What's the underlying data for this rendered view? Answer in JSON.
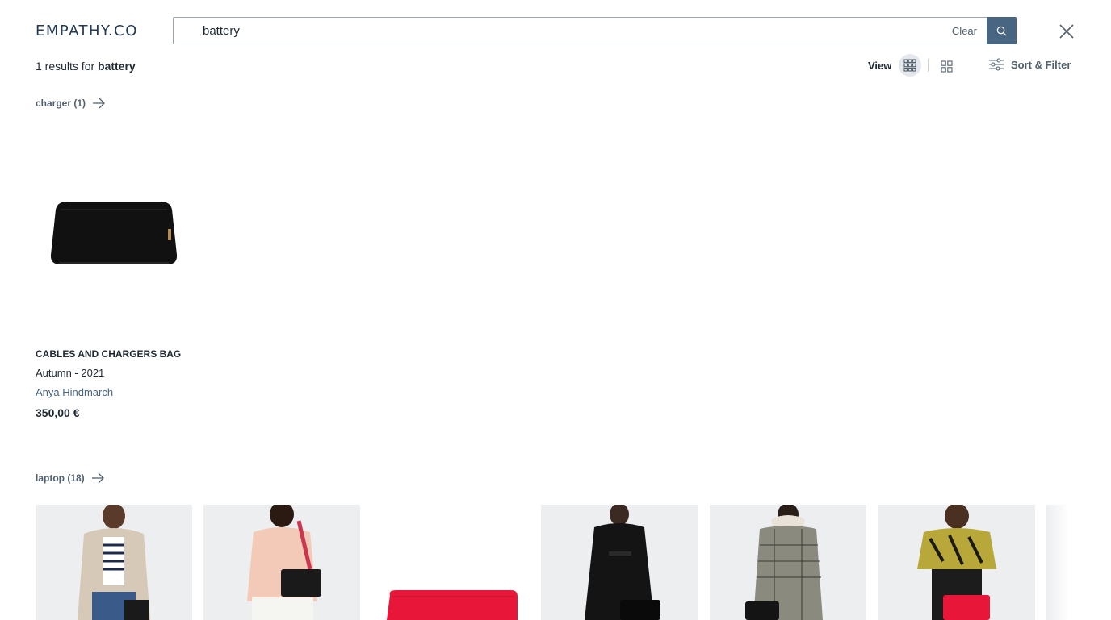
{
  "header": {
    "logo": "EMPATHY.CO",
    "search_value": "battery",
    "clear_label": "Clear"
  },
  "results": {
    "count_prefix": "1 results for",
    "query": "battery"
  },
  "toolbar": {
    "view_label": "View",
    "sort_filter_label": "Sort & Filter"
  },
  "groups": [
    {
      "label": "charger (1)"
    },
    {
      "label": "laptop (18)"
    }
  ],
  "product": {
    "name": "CABLES AND CHARGERS BAG",
    "collection": "Autumn - 2021",
    "brand": "Anya Hindmarch",
    "price": "350,00 €"
  },
  "colors": {
    "accent": "#486581",
    "text": "#1f2933",
    "muted": "#52606d"
  },
  "icons": [
    "search-icon",
    "close-icon",
    "grid-6-icon",
    "grid-4-icon",
    "sliders-icon",
    "arrow-right-icon"
  ]
}
